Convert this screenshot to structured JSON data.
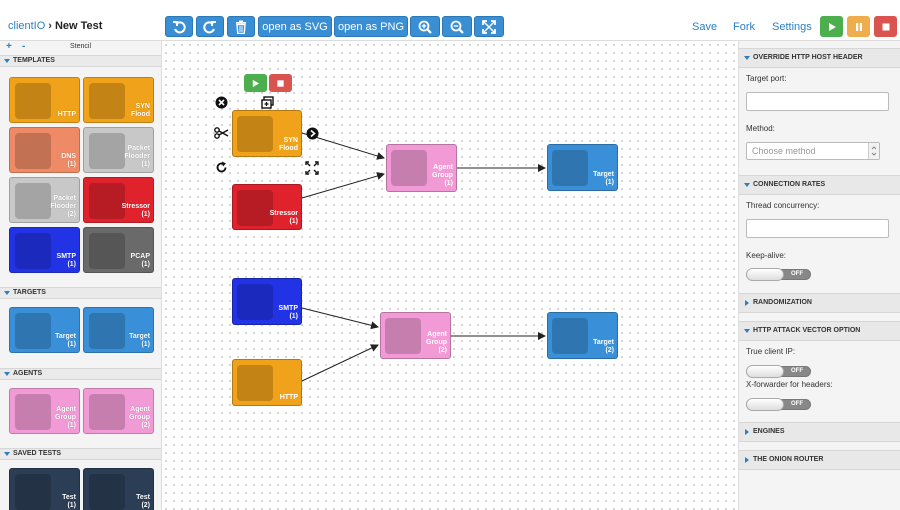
{
  "header": {
    "app_name": "clientIO",
    "test_name": "New Test",
    "toolbar": {
      "svg_label": "open as SVG",
      "png_label": "open as PNG"
    },
    "links": {
      "save": "Save",
      "fork": "Fork",
      "settings": "Settings"
    }
  },
  "stencil": {
    "plus": "+",
    "minus": "-",
    "label": "Stencil",
    "sections": {
      "templates": "TEMPLATES",
      "targets": "TARGETS",
      "agents": "AGENTS",
      "saved_tests": "SAVED TESTS"
    },
    "templates": [
      {
        "name": "HTTP",
        "count": "",
        "color": "#f0a21a"
      },
      {
        "name": "SYN\nFlood",
        "count": "",
        "color": "#f0a21a"
      },
      {
        "name": "DNS",
        "count": "(1)",
        "color": "#ee8a66"
      },
      {
        "name": "Packet\nFlooder",
        "count": "(1)",
        "color": "#c8c8c8"
      },
      {
        "name": "Packet\nFlooder",
        "count": "(2)",
        "color": "#c8c8c8"
      },
      {
        "name": "Stressor",
        "count": "(1)",
        "color": "#e0222c"
      },
      {
        "name": "SMTP",
        "count": "(1)",
        "color": "#2233e6"
      },
      {
        "name": "PCAP",
        "count": "(1)",
        "color": "#6a6a6a"
      }
    ],
    "targets": [
      {
        "name": "Target",
        "count": "(1)",
        "color": "#3a90d8"
      },
      {
        "name": "Target",
        "count": "(1)",
        "color": "#3a90d8"
      }
    ],
    "agents": [
      {
        "name": "Agent\nGroup",
        "count": "(1)",
        "color": "#f29ad6"
      },
      {
        "name": "Agent\nGroup",
        "count": "(2)",
        "color": "#f29ad6"
      }
    ],
    "saved": [
      {
        "name": "Test",
        "count": "(1)",
        "color": "#2c3e55"
      },
      {
        "name": "Test",
        "count": "(2)",
        "color": "#2c3e55"
      }
    ]
  },
  "canvas": {
    "nodes": {
      "syn": {
        "label": "SYN\nFlood",
        "count": ""
      },
      "stressor": {
        "label": "Stressor",
        "count": "(1)"
      },
      "agent1": {
        "label": "Agent\nGroup",
        "count": "(1)"
      },
      "target1": {
        "label": "Target",
        "count": "(1)"
      },
      "smtp": {
        "label": "SMTP",
        "count": "(1)"
      },
      "http": {
        "label": "HTTP",
        "count": ""
      },
      "agent2": {
        "label": "Agent\nGroup",
        "count": "(2)"
      },
      "target2": {
        "label": "Target",
        "count": "(2)"
      }
    }
  },
  "inspector": {
    "sections": {
      "override": "OVERRIDE HTTP HOST HEADER",
      "connection": "CONNECTION RATES",
      "randomization": "RANDOMIZATION",
      "attack_vector": "HTTP ATTACK VECTOR OPTION",
      "engines": "ENGINES",
      "onion": "THE ONION ROUTER"
    },
    "target_port_label": "Target port:",
    "target_port_value": "",
    "method_label": "Method:",
    "method_placeholder": "Choose method",
    "thread_concurrency_label": "Thread concurrency:",
    "thread_concurrency_value": "",
    "keep_alive_label": "Keep-alive:",
    "keep_alive_state": "OFF",
    "true_client_ip_label": "True client IP:",
    "true_client_ip_state": "OFF",
    "x_forwarder_label": "X-forwarder for headers:",
    "x_forwarder_state": "OFF"
  },
  "colors": {
    "accent": "#3a8fd4",
    "run": "#4cae4c",
    "pause": "#f0ad4e",
    "stop": "#d9534f"
  }
}
